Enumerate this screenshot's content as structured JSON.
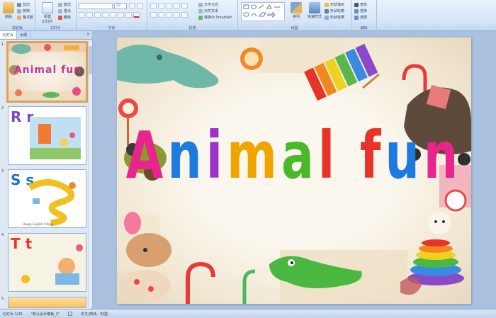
{
  "ribbon": {
    "clipboard": {
      "label": "剪贴板",
      "paste": "粘贴",
      "cut": "剪切",
      "copy": "复制",
      "format_painter": "格式刷"
    },
    "slides": {
      "label": "幻灯片",
      "new_slide": "新建\n幻灯片",
      "layout": "版式",
      "reset": "重设",
      "delete": "删除"
    },
    "font": {
      "label": "字体",
      "font_size": "32"
    },
    "paragraph": {
      "label": "段落",
      "text_direction": "文字方向",
      "align_text": "对齐文本",
      "smartart": "转换为 SmartArt"
    },
    "drawing": {
      "label": "绘图",
      "arrange": "排列",
      "quick_styles": "快速样式",
      "shape_fill": "形状填充",
      "shape_outline": "形状轮廓",
      "shape_effects": "形状效果"
    },
    "editing": {
      "label": "编辑",
      "find": "查找",
      "replace": "替换",
      "select": "选择"
    }
  },
  "panel": {
    "tab_slides": "幻灯片",
    "tab_outline": "大纲",
    "close": "×",
    "thumbnails": [
      {
        "num": "1",
        "text": "Animal fun"
      },
      {
        "num": "2",
        "text": "R r"
      },
      {
        "num": "3",
        "text": "S s"
      },
      {
        "num": "4",
        "text": "T t"
      },
      {
        "num": "5",
        "text": ""
      }
    ],
    "thumb3_caption": "Happy English Village"
  },
  "slide": {
    "title_letters": [
      "A",
      "n",
      "i",
      "m",
      "a",
      "l",
      " ",
      "f",
      "u",
      "n"
    ]
  },
  "status": {
    "slide_count": "幻灯片 1/15",
    "theme": "\"默认设计模板_2\"",
    "language": "中文(简体，中国)"
  },
  "colors": {
    "title_pink": "#e7258c",
    "title_blue": "#1f7ae0",
    "title_purple": "#9b32c9",
    "title_orange": "#f0a400",
    "title_green": "#4ab82a",
    "title_red": "#e8332a",
    "selection": "#f0a030"
  }
}
